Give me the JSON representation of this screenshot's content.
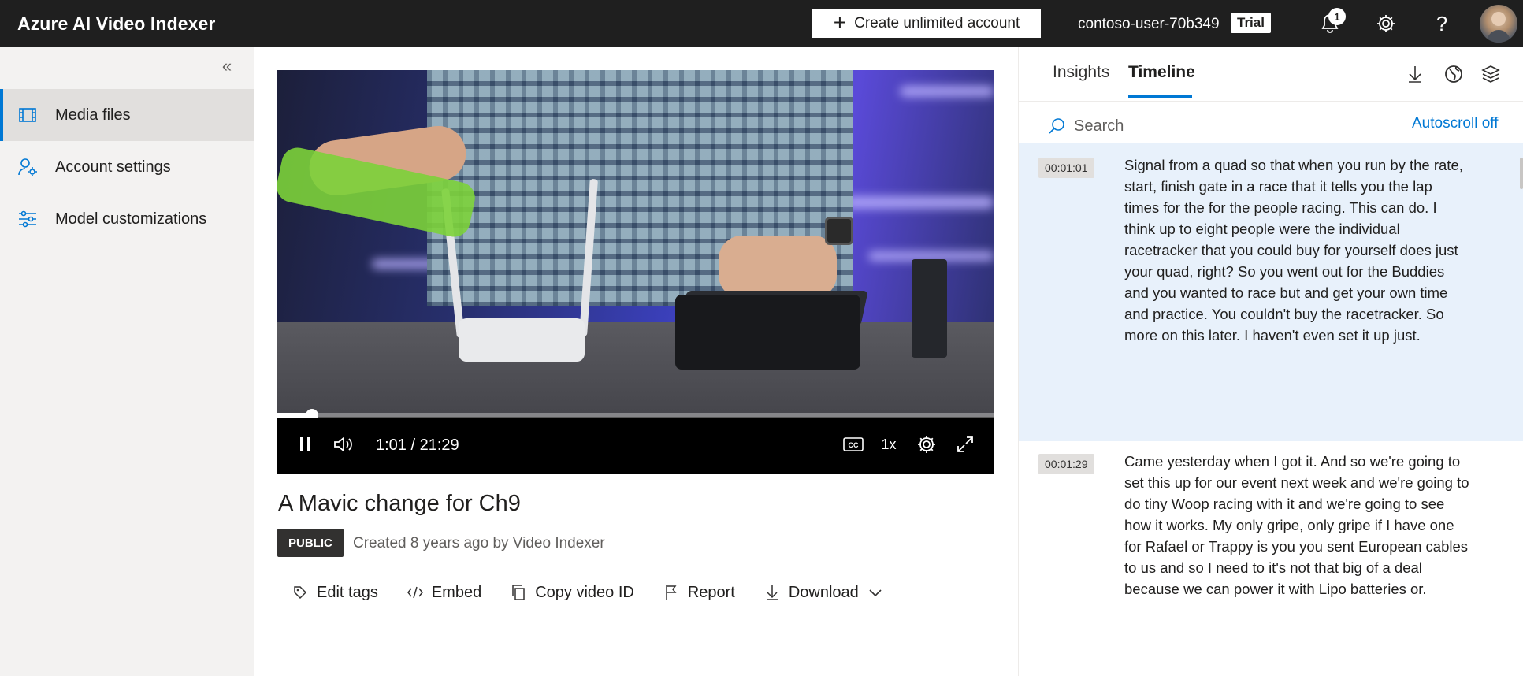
{
  "header": {
    "app_title": "Azure AI Video Indexer",
    "create_account_label": "Create unlimited account",
    "user_name": "contoso-user-70b349",
    "trial_label": "Trial",
    "notification_count": "1",
    "help_label": "?"
  },
  "sidebar": {
    "collapse_label": "«",
    "items": [
      {
        "label": "Media files",
        "icon": "film-icon",
        "active": true
      },
      {
        "label": "Account settings",
        "icon": "user-settings-icon",
        "active": false
      },
      {
        "label": "Model customizations",
        "icon": "sliders-icon",
        "active": false
      }
    ]
  },
  "player": {
    "time_display": "1:01 / 21:29",
    "progress_fraction": 0.048,
    "speed_label": "1x",
    "cc_label": "CC"
  },
  "video": {
    "title": "A Mavic change for Ch9",
    "visibility_badge": "PUBLIC",
    "created_text": "Created 8 years ago by Video Indexer",
    "actions": [
      {
        "label": "Edit tags",
        "icon": "tag-icon"
      },
      {
        "label": "Embed",
        "icon": "code-icon"
      },
      {
        "label": "Copy video ID",
        "icon": "copy-icon"
      },
      {
        "label": "Report",
        "icon": "flag-icon"
      },
      {
        "label": "Download",
        "icon": "download-icon"
      }
    ]
  },
  "panel": {
    "tabs": [
      {
        "label": "Insights",
        "active": false
      },
      {
        "label": "Timeline",
        "active": true
      }
    ],
    "search_placeholder": "Search",
    "autoscroll_label": "Autoscroll off",
    "segments": [
      {
        "time": "00:01:01",
        "text": "Signal from a quad so that when you run by the rate, start, finish gate in a race that it tells you the lap times for the for the people racing. This can do. I think up to eight people were the individual racetracker that you could buy for yourself does just your quad, right? So you went out for the Buddies and you wanted to race but and get your own time and practice. You couldn't buy the racetracker. So more on this later. I haven't even set it up just.",
        "highlighted": true
      },
      {
        "time": "00:01:29",
        "text": "Came yesterday when I got it. And so we're going to set this up for our event next week and we're going to do tiny Woop racing with it and we're going to see how it works. My only gripe, only gripe if I have one for Rafael or Trappy is you you sent European cables to us and so I need to it's not that big of a deal because we can power it with Lipo batteries or.",
        "highlighted": false
      }
    ]
  },
  "colors": {
    "accent": "#0078d4",
    "topbar": "#1f1f1f",
    "sidebar_bg": "#f3f2f1",
    "highlight_bg": "#e8f1fb"
  }
}
